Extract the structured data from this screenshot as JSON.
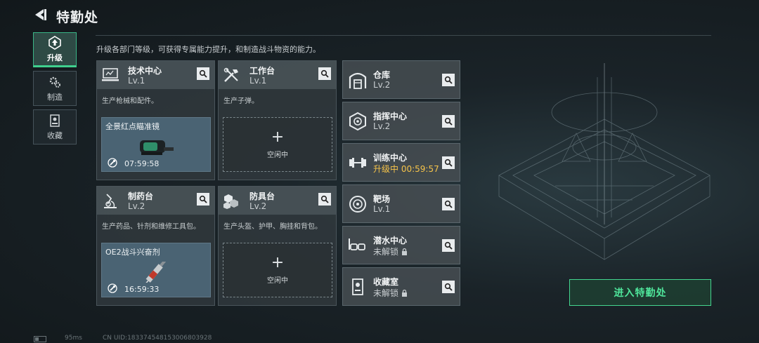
{
  "header": {
    "title": "特勤处"
  },
  "description": "升级各部门等级，可获得专属能力提升，和制造战斗物资的能力。",
  "sidebar": {
    "items": [
      {
        "label": "升级",
        "icon": "upgrade-icon",
        "active": true
      },
      {
        "label": "制造",
        "icon": "gears-icon",
        "active": false
      },
      {
        "label": "收藏",
        "icon": "collection-icon",
        "active": false
      }
    ]
  },
  "workshops": [
    {
      "name": "技术中心",
      "level": "Lv.1",
      "icon": "tech-center-icon",
      "desc": "生产枪械和配件。",
      "state": "crafting",
      "item": "全景红点瞄准镜",
      "time": "07:59:58"
    },
    {
      "name": "工作台",
      "level": "Lv.1",
      "icon": "workbench-icon",
      "desc": "生产子弹。",
      "state": "idle",
      "idle_label": "空闲中"
    },
    {
      "name": "制药台",
      "level": "Lv.2",
      "icon": "pharmacy-icon",
      "desc": "生产药品、针剂和维修工具包。",
      "state": "crafting",
      "item": "OE2战斗兴奋剂",
      "time": "16:59:33"
    },
    {
      "name": "防具台",
      "level": "Lv.2",
      "icon": "armor-bench-icon",
      "desc": "生产头盔、护甲、胸挂和背包。",
      "state": "idle",
      "idle_label": "空闲中"
    }
  ],
  "facilities": [
    {
      "name": "仓库",
      "status": "Lv.2",
      "icon": "warehouse-icon"
    },
    {
      "name": "指挥中心",
      "status": "Lv.2",
      "icon": "command-center-icon"
    },
    {
      "name": "训练中心",
      "status": "升级中 00:59:57",
      "icon": "training-center-icon",
      "upgrading": true
    },
    {
      "name": "靶场",
      "status": "Lv.1",
      "icon": "shooting-range-icon"
    },
    {
      "name": "潜水中心",
      "status": "未解锁",
      "icon": "diving-center-icon",
      "locked": true
    },
    {
      "name": "收藏室",
      "status": "未解锁",
      "icon": "collection-room-icon",
      "locked": true
    }
  ],
  "enter_button": "进入特勤处",
  "footer": {
    "ping": "95ms",
    "uid": "CN UID:183374548153006803928"
  },
  "colors": {
    "accent_green": "#44d68f",
    "upgrade_yellow": "#f5c34a",
    "craft_blue": "#4a6373"
  }
}
